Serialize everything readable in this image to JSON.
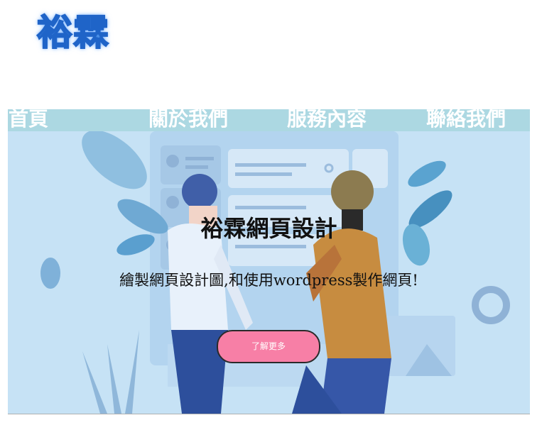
{
  "brand": {
    "logo_text": "裕霖"
  },
  "nav": {
    "items": [
      {
        "label": "首頁"
      },
      {
        "label": "關於我們"
      },
      {
        "label": "服務內容"
      },
      {
        "label": "聯絡我們"
      }
    ]
  },
  "hero": {
    "title": "裕霖網頁設計",
    "subtitle": "繪製網頁設計圖,和使用wordpress製作網頁!",
    "button_label": "了解更多",
    "background_image": "illustration-two-people-walking",
    "button_color": "#f77fa6",
    "background_color": "#c6e2f5"
  },
  "colors": {
    "nav_bar": "#acd8e2",
    "logo": "#4a8fe6"
  }
}
